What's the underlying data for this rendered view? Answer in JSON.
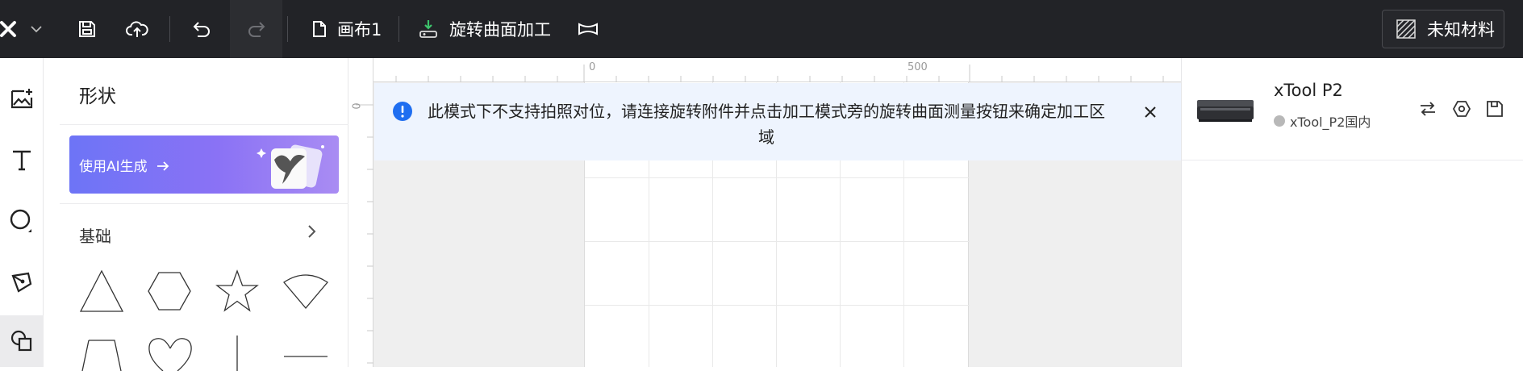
{
  "toolbar": {
    "canvas_name": "画布1",
    "mode_label": "旋转曲面加工",
    "material_label": "未知材料",
    "icons": [
      "logo-x-icon",
      "chevron-down-icon",
      "save-icon",
      "cloud-upload-icon",
      "undo-icon",
      "redo-icon",
      "document-icon",
      "rotary-mode-icon",
      "rotary-attachment-icon",
      "material-texture-icon"
    ]
  },
  "rail": {
    "items": [
      "image-icon",
      "text-icon",
      "circle-shape-icon",
      "pen-icon",
      "shapes-icon"
    ],
    "active": "shapes-icon"
  },
  "panel": {
    "title": "形状",
    "ai_button_label": "使用AI生成",
    "section_label": "基础",
    "shapes": [
      "triangle",
      "hexagon",
      "star",
      "sector",
      "trapezoid",
      "heart",
      "vertical-line",
      "horizontal-line"
    ]
  },
  "canvas": {
    "ruler_top": [
      "0",
      "500"
    ],
    "ruler_left": [
      "0"
    ]
  },
  "notice": {
    "text": "此模式下不支持拍照对位，请连接旋转附件并点击加工模式旁的旋转曲面测量按钮来确定加工区域"
  },
  "device": {
    "name": "xTool P2",
    "subtitle": "xTool_P2国内",
    "status_color": "#b8b8b8",
    "actions": [
      "swap-icon",
      "settings-icon",
      "save-config-icon"
    ]
  }
}
